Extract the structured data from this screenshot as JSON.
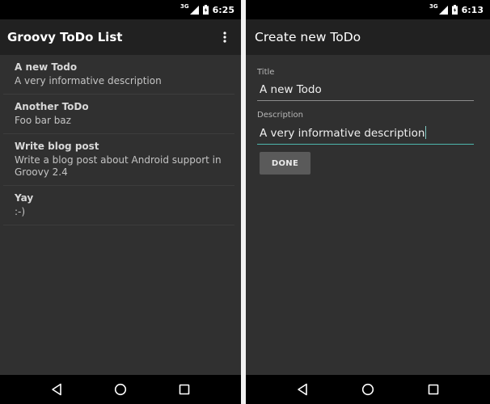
{
  "left": {
    "status": {
      "network": "3G",
      "time": "6:25"
    },
    "appbar": {
      "title": "Groovy ToDo List",
      "overflow_icon": "more-vert-icon"
    },
    "todos": [
      {
        "title": "A new Todo",
        "description": "A very informative description"
      },
      {
        "title": "Another ToDo",
        "description": "Foo bar baz"
      },
      {
        "title": "Write blog post",
        "description": "Write a blog post about Android support in Groovy 2.4"
      },
      {
        "title": "Yay",
        "description": ":-)"
      }
    ]
  },
  "right": {
    "status": {
      "network": "3G",
      "time": "6:13"
    },
    "appbar": {
      "title": "Create new ToDo"
    },
    "form": {
      "title_label": "Title",
      "title_value": "A new Todo",
      "description_label": "Description",
      "description_value": "A very informative description",
      "done_label": "DONE"
    }
  },
  "colors": {
    "background": "#303030",
    "appbar": "#212121",
    "accent": "#4db6ac",
    "button": "#5a5a5a"
  }
}
